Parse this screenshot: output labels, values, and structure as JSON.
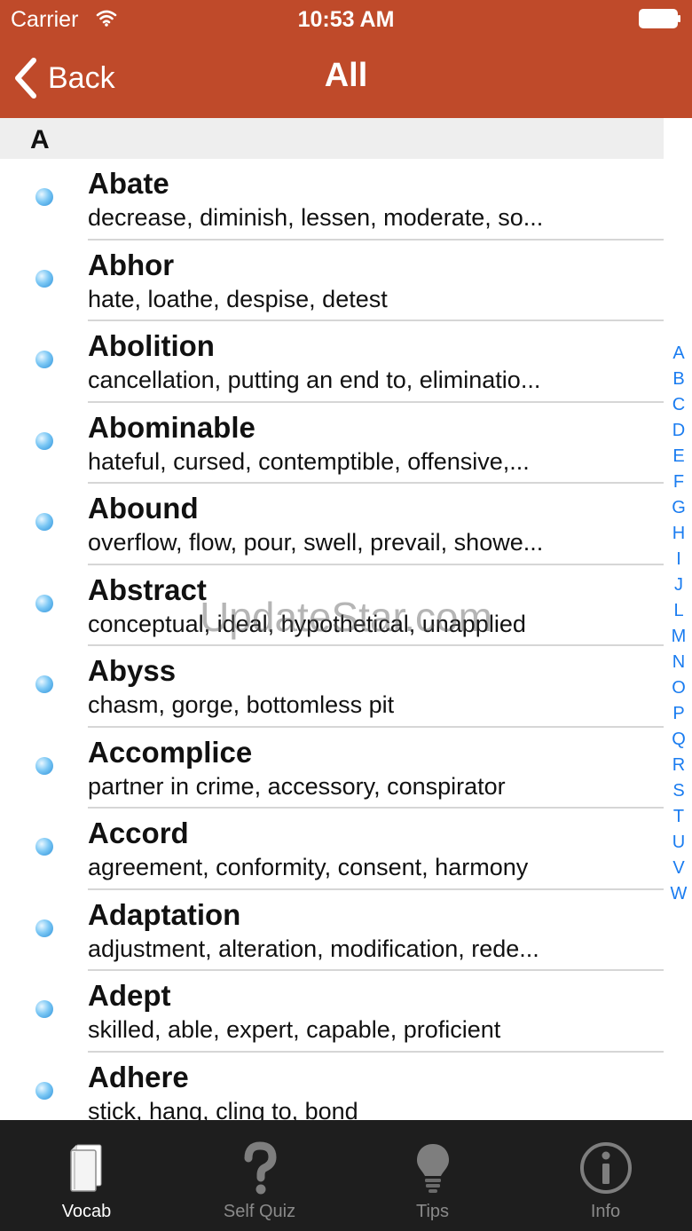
{
  "status_bar": {
    "carrier": "Carrier",
    "time": "10:53 AM"
  },
  "nav": {
    "back_label": "Back",
    "title": "All"
  },
  "section": {
    "letter": "A"
  },
  "entries": [
    {
      "word": "Abate",
      "synonyms": "decrease, diminish, lessen, moderate, so..."
    },
    {
      "word": "Abhor",
      "synonyms": "hate, loathe, despise, detest"
    },
    {
      "word": "Abolition",
      "synonyms": "cancellation, putting an end to, eliminatio..."
    },
    {
      "word": "Abominable",
      "synonyms": "hateful, cursed, contemptible, offensive,..."
    },
    {
      "word": "Abound",
      "synonyms": "overflow, flow, pour, swell, prevail, showe..."
    },
    {
      "word": "Abstract",
      "synonyms": "conceptual, ideal, hypothetical, unapplied"
    },
    {
      "word": "Abyss",
      "synonyms": "chasm, gorge, bottomless pit"
    },
    {
      "word": "Accomplice",
      "synonyms": "partner in crime, accessory, conspirator"
    },
    {
      "word": "Accord",
      "synonyms": "agreement, conformity, consent, harmony"
    },
    {
      "word": "Adaptation",
      "synonyms": "adjustment, alteration, modification, rede..."
    },
    {
      "word": "Adept",
      "synonyms": "skilled, able, expert, capable, proficient"
    },
    {
      "word": "Adhere",
      "synonyms": "stick, hang, cling to, bond"
    }
  ],
  "index_letters": [
    "A",
    "B",
    "C",
    "D",
    "E",
    "F",
    "G",
    "H",
    "I",
    "J",
    "L",
    "M",
    "N",
    "O",
    "P",
    "Q",
    "R",
    "S",
    "T",
    "U",
    "V",
    "W"
  ],
  "watermark": "UpdateStar.com",
  "tabs": [
    {
      "label": "Vocab",
      "icon": "book-icon",
      "active": true
    },
    {
      "label": "Self Quiz",
      "icon": "question-mark-icon",
      "active": false
    },
    {
      "label": "Tips",
      "icon": "lightbulb-icon",
      "active": false
    },
    {
      "label": "Info",
      "icon": "info-icon",
      "active": false
    }
  ],
  "colors": {
    "header": "#bf4a2a",
    "index": "#1a7cf0",
    "tab_bar": "#1e1e1e"
  }
}
